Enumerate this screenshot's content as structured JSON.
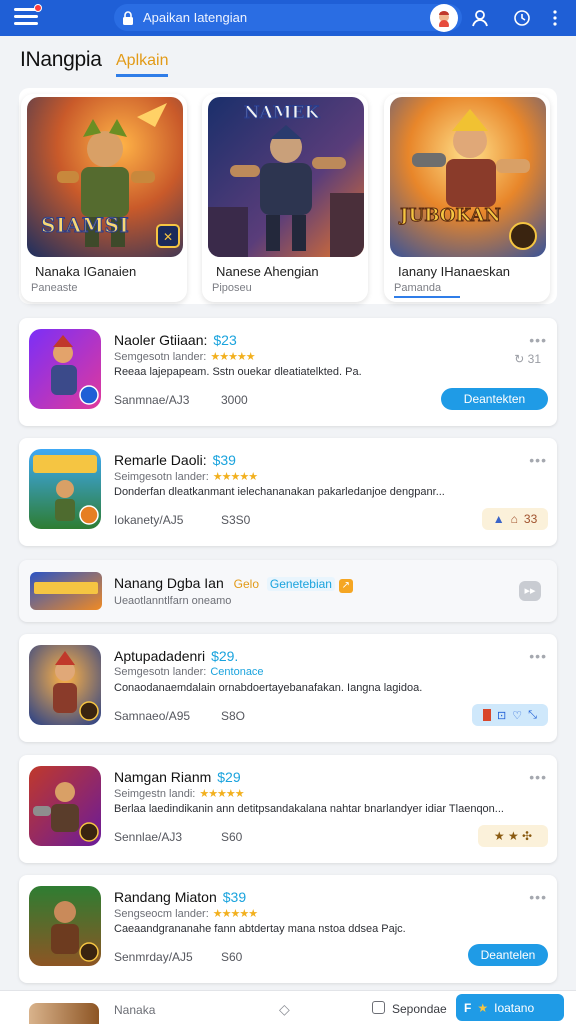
{
  "topbar": {
    "search_placeholder": "Apaikan Iatengian"
  },
  "header": {
    "title": "INangpia",
    "tab_label": "Aplkain"
  },
  "featured": [
    {
      "art_text": "SIAMSI",
      "title": "Nanaka IGanaien",
      "subtitle": "Paneaste",
      "palette": [
        "#3b6bd0",
        "#f59b2a"
      ]
    },
    {
      "art_text": "NAMEK",
      "title": "Nanese Ahengian",
      "subtitle": "Piposeu",
      "palette": [
        "#1c3a7a",
        "#e8752a"
      ]
    },
    {
      "art_text": "JUBOKAN",
      "title": "Ianany IHanaeskan",
      "subtitle": "Pamanda",
      "palette": [
        "#2c5bb8",
        "#f5a425"
      ]
    }
  ],
  "apps": [
    {
      "title": "Naoler Gtiiaan:",
      "price": "$23",
      "subtitle": "Semgesotn lander:",
      "stars": "★★★★★",
      "desc": "Reeaa lajepapeam. Sstn ouekar dleatiatelkted. Pa.",
      "size": "Sanmnae/AJ3",
      "downloads": "3000",
      "action": "Deantekten",
      "action_type": "button",
      "side_icon": "↻ 31"
    },
    {
      "title": "Remarle Daoli:",
      "price": "$39",
      "subtitle": "Seimgesotn lander:",
      "stars": "★★★★★",
      "desc": "Donderfan dleatkanmant ielechananakan pakarledanjoe dengpanr...",
      "size": "Iokanety/AJ5",
      "downloads": "S3S0",
      "action": "33",
      "action_type": "badge-tan"
    },
    {
      "title": "Nanang Dgba Ian",
      "price": "Gelo",
      "subtitle": "Ueaotlanntlfarn oneamo",
      "extra_tag": "Genetebian",
      "action_type": "ad"
    },
    {
      "title": "Aptupadadenri",
      "price": "$29.",
      "subtitle": "Semgesotn lander:",
      "tag": "Centonace",
      "desc": "Conaodanaemdalain ornabdoertayebanafakan. Iangna lagidoa.",
      "size": "Samnaeo/A95",
      "downloads": "S8O",
      "action": "",
      "action_type": "badge-blue"
    },
    {
      "title": "Namgan Rianm",
      "price": "$29",
      "subtitle": "Seimgestn landi:",
      "stars": "★★★★★",
      "desc": "Berlaa laedindikanin ann detitpsandakalana nahtar bnarlandyer idiar Tlaenqon...",
      "size": "Sennlae/AJ3",
      "downloads": "S60",
      "action": "★ ★ ✣",
      "action_type": "badge-tan"
    },
    {
      "title": "Randang Miaton",
      "price": "$39",
      "subtitle": "Sengseocm lander:",
      "stars": "★★★★★",
      "desc": "Caeaandgrananahe fann abtdertay mana nstoa ddsea Pajc.",
      "size": "Senmrday/AJ5",
      "downloads": "S60",
      "action": "Deantelen",
      "action_type": "button"
    }
  ],
  "bottom": {
    "left_label": "Nanaka",
    "mid_label": "Sepondae",
    "right_label": "Ioatano"
  },
  "colors": {
    "topbar": "#1f5fd6",
    "accent_blue": "#1f9be6",
    "price": "#1aa3dd",
    "star": "#f2b01e"
  }
}
